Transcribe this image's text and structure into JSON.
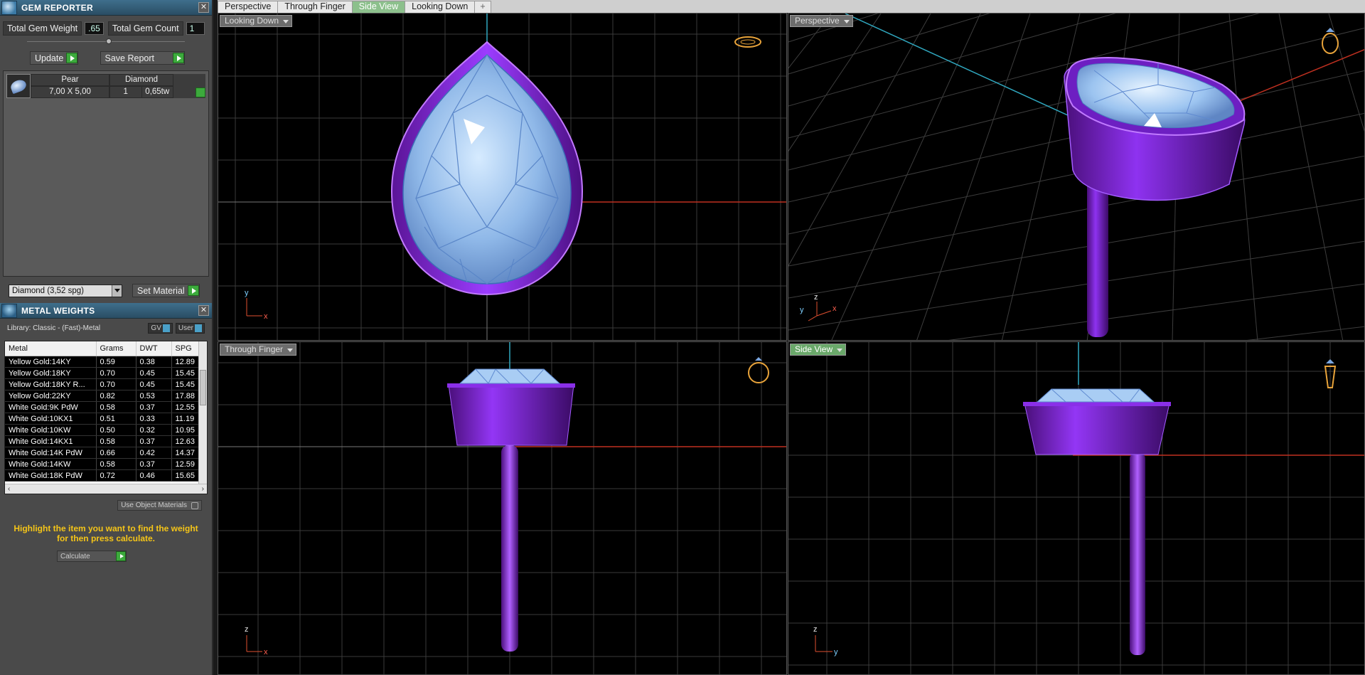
{
  "gem_reporter": {
    "title": "GEM REPORTER",
    "total_weight_label": "Total Gem Weight",
    "total_weight_value": ".65",
    "total_count_label": "Total Gem Count",
    "total_count_value": "1",
    "update_label": "Update",
    "save_report_label": "Save Report",
    "gem": {
      "shape": "Pear",
      "type": "Diamond",
      "size": "7,00 X 5,00",
      "count": "1",
      "weight": "0,65tw"
    },
    "material_select": "Diamond     (3,52 spg)",
    "set_material_label": "Set Material"
  },
  "metal_weights": {
    "title": "METAL WEIGHTS",
    "library": "Library: Classic - (Fast)-Metal",
    "gv_label": "GV",
    "user_label": "User",
    "columns": [
      "Metal",
      "Grams",
      "DWT",
      "SPG"
    ],
    "rows": [
      [
        "Yellow Gold:14KY",
        "0.59",
        "0.38",
        "12.89"
      ],
      [
        "Yellow Gold:18KY",
        "0.70",
        "0.45",
        "15.45"
      ],
      [
        "Yellow Gold:18KY R...",
        "0.70",
        "0.45",
        "15.45"
      ],
      [
        "Yellow Gold:22KY",
        "0.82",
        "0.53",
        "17.88"
      ],
      [
        "White Gold:9K PdW",
        "0.58",
        "0.37",
        "12.55"
      ],
      [
        "White Gold:10KX1",
        "0.51",
        "0.33",
        "11.19"
      ],
      [
        "White Gold:10KW",
        "0.50",
        "0.32",
        "10.95"
      ],
      [
        "White Gold:14KX1",
        "0.58",
        "0.37",
        "12.63"
      ],
      [
        "White Gold:14K PdW",
        "0.66",
        "0.42",
        "14.37"
      ],
      [
        "White Gold:14KW",
        "0.58",
        "0.37",
        "12.59"
      ],
      [
        "White Gold:18K PdW",
        "0.72",
        "0.46",
        "15.65"
      ]
    ],
    "use_object_materials": "Use Object Materials",
    "hint": "Highlight the item you want to find the weight for then press calculate.",
    "calculate_label": "Calculate"
  },
  "tabs": [
    {
      "label": "Perspective",
      "active": false
    },
    {
      "label": "Through Finger",
      "active": false
    },
    {
      "label": "Side View",
      "active": true
    },
    {
      "label": "Looking Down",
      "active": false
    }
  ],
  "viewports": {
    "top_left": "Looking Down",
    "top_right": "Perspective",
    "bottom_left": "Through Finger",
    "bottom_right": "Side View"
  },
  "axes": {
    "top_left": [
      "y",
      "x"
    ],
    "top_right": [
      "y",
      "z",
      "x"
    ],
    "bottom_left": [
      "z",
      "x"
    ],
    "bottom_right": [
      "z",
      "y"
    ]
  },
  "colors": {
    "metal": "#7a1fc0",
    "gem": "#9cc4f0",
    "grid": "#3a3a3a",
    "axis_x": "#c03020",
    "axis_y": "#30a8c0",
    "active_tab": "#8cc08c"
  }
}
